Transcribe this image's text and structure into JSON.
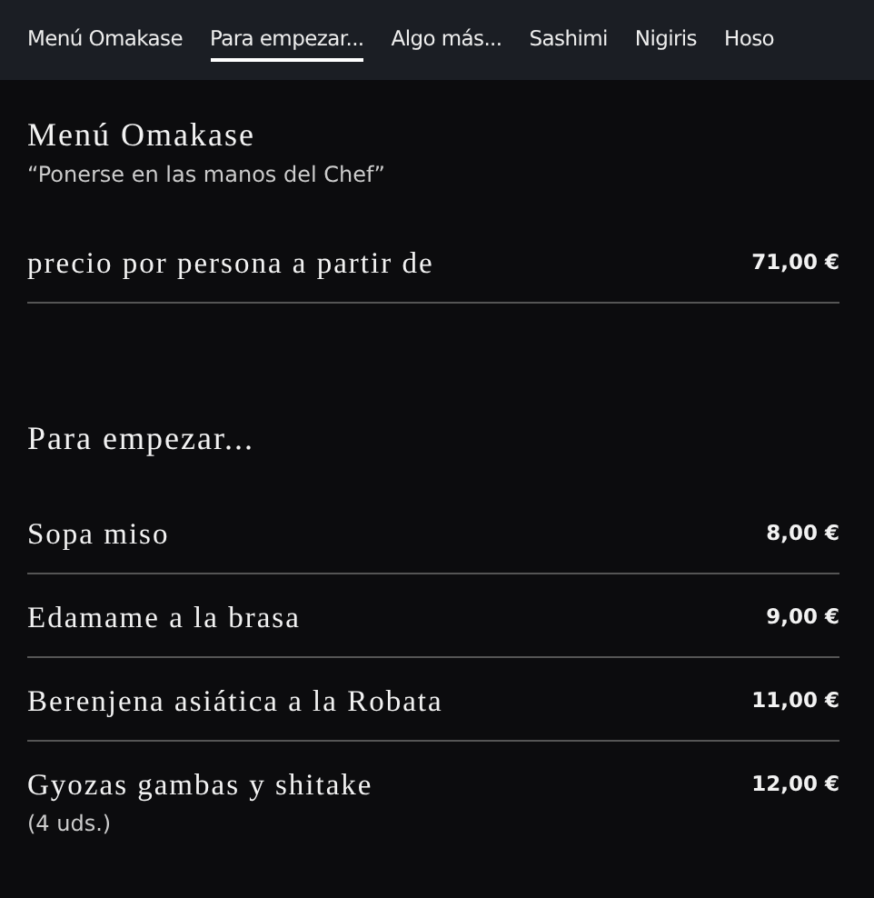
{
  "tabs": [
    {
      "label": "Menú Omakase",
      "selected": false
    },
    {
      "label": "Para empezar...",
      "selected": true
    },
    {
      "label": "Algo más...",
      "selected": false
    },
    {
      "label": "Sashimi",
      "selected": false
    },
    {
      "label": "Nigiris",
      "selected": false
    },
    {
      "label": "Hoso",
      "selected": false
    }
  ],
  "sections": [
    {
      "title": "Menú Omakase",
      "subtitle": "“Ponerse en las manos del Chef”",
      "items": [
        {
          "name": "precio por persona a partir de",
          "price": "71,00 €"
        }
      ]
    },
    {
      "title": "Para empezar...",
      "items": [
        {
          "name": "Sopa miso",
          "price": "8,00 €"
        },
        {
          "name": "Edamame a la brasa",
          "price": "9,00 €"
        },
        {
          "name": "Berenjena asiática a la Robata",
          "price": "11,00 €"
        },
        {
          "name": "Gyozas gambas y shitake",
          "note": "(4 uds.)",
          "price": "12,00 €"
        }
      ]
    }
  ]
}
